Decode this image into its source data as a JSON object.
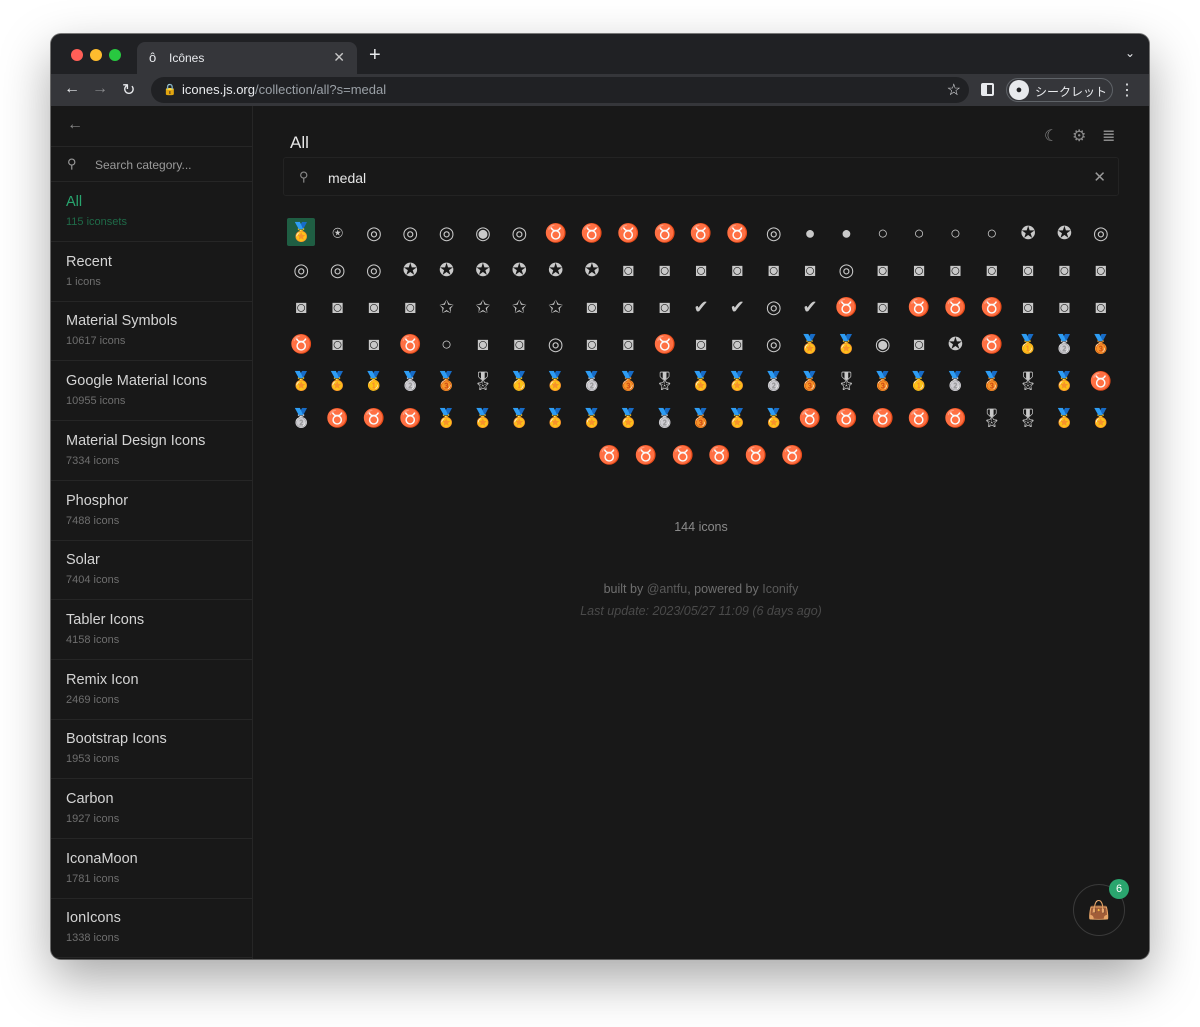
{
  "browser": {
    "tab_title": "Icônes",
    "tab_favicon": "ô",
    "url_host": "icones.js.org",
    "url_path": "/collection/all?s=medal",
    "incognito_label": "シークレット"
  },
  "sidebar": {
    "search_placeholder": "Search category...",
    "items": [
      {
        "name": "All",
        "count": "115 iconsets"
      },
      {
        "name": "Recent",
        "count": "1 icons"
      },
      {
        "name": "Material Symbols",
        "count": "10617 icons"
      },
      {
        "name": "Google Material Icons",
        "count": "10955 icons"
      },
      {
        "name": "Material Design Icons",
        "count": "7334 icons"
      },
      {
        "name": "Phosphor",
        "count": "7488 icons"
      },
      {
        "name": "Solar",
        "count": "7404 icons"
      },
      {
        "name": "Tabler Icons",
        "count": "4158 icons"
      },
      {
        "name": "Remix Icon",
        "count": "2469 icons"
      },
      {
        "name": "Bootstrap Icons",
        "count": "1953 icons"
      },
      {
        "name": "Carbon",
        "count": "1927 icons"
      },
      {
        "name": "IconaMoon",
        "count": "1781 icons"
      },
      {
        "name": "IonIcons",
        "count": "1338 icons"
      }
    ]
  },
  "main": {
    "title": "All",
    "search_value": "medal",
    "icon_count_label": "144 icons",
    "footer_built_by": "built by",
    "footer_author": "@antfu",
    "footer_powered": ", powered by",
    "footer_iconify": "Iconify",
    "footer_update": "Last update: 2023/05/27 11:09 (6 days ago)",
    "bag_count": "6"
  },
  "colors": {
    "accent": "#28a56e",
    "background": "#181818"
  },
  "icons": {
    "row_lengths": [
      23,
      23,
      23,
      23,
      23,
      23,
      6
    ],
    "glyphs": [
      "🏅",
      "⍟",
      "◎",
      "◎",
      "◎",
      "◉",
      "◎",
      "♉",
      "♉",
      "♉",
      "♉",
      "♉",
      "♉",
      "◎",
      "●",
      "●",
      "○",
      "○",
      "○",
      "○",
      "✪",
      "✪",
      "◎",
      "◎",
      "◎",
      "◎",
      "✪",
      "✪",
      "✪",
      "✪",
      "✪",
      "✪",
      "◙",
      "◙",
      "◙",
      "◙",
      "◙",
      "◙",
      "◎",
      "◙",
      "◙",
      "◙",
      "◙",
      "◙",
      "◙",
      "◙",
      "◙",
      "◙",
      "◙",
      "◙",
      "✩",
      "✩",
      "✩",
      "✩",
      "◙",
      "◙",
      "◙",
      "✔",
      "✔",
      "◎",
      "✔",
      "♉",
      "◙",
      "♉",
      "♉",
      "♉",
      "◙",
      "◙",
      "◙",
      "♉",
      "◙",
      "◙",
      "♉",
      "○",
      "◙",
      "◙",
      "◎",
      "◙",
      "◙",
      "♉",
      "◙",
      "◙",
      "◎",
      "🏅",
      "🏅",
      "◉",
      "◙",
      "✪",
      "♉",
      "🥇",
      "🥈",
      "🥉",
      "🏅",
      "🏅",
      "🥇",
      "🥈",
      "🥉",
      "🎖",
      "🥇",
      "🏅",
      "🥈",
      "🥉",
      "🎖",
      "🏅",
      "🏅",
      "🥈",
      "🥉",
      "🎖",
      "🥉",
      "🥇",
      "🥈",
      "🥉",
      "🎖",
      "🏅",
      "♉",
      "🥈",
      "♉",
      "♉",
      "♉",
      "🏅",
      "🏅",
      "🏅",
      "🏅",
      "🏅",
      "🏅",
      "🥈",
      "🥉",
      "🏅",
      "🏅",
      "♉",
      "♉",
      "♉",
      "♉",
      "♉",
      "🎖",
      "🎖",
      "🏅",
      "🏅",
      "♉",
      "♉",
      "♉",
      "♉",
      "♉",
      "♉"
    ]
  }
}
